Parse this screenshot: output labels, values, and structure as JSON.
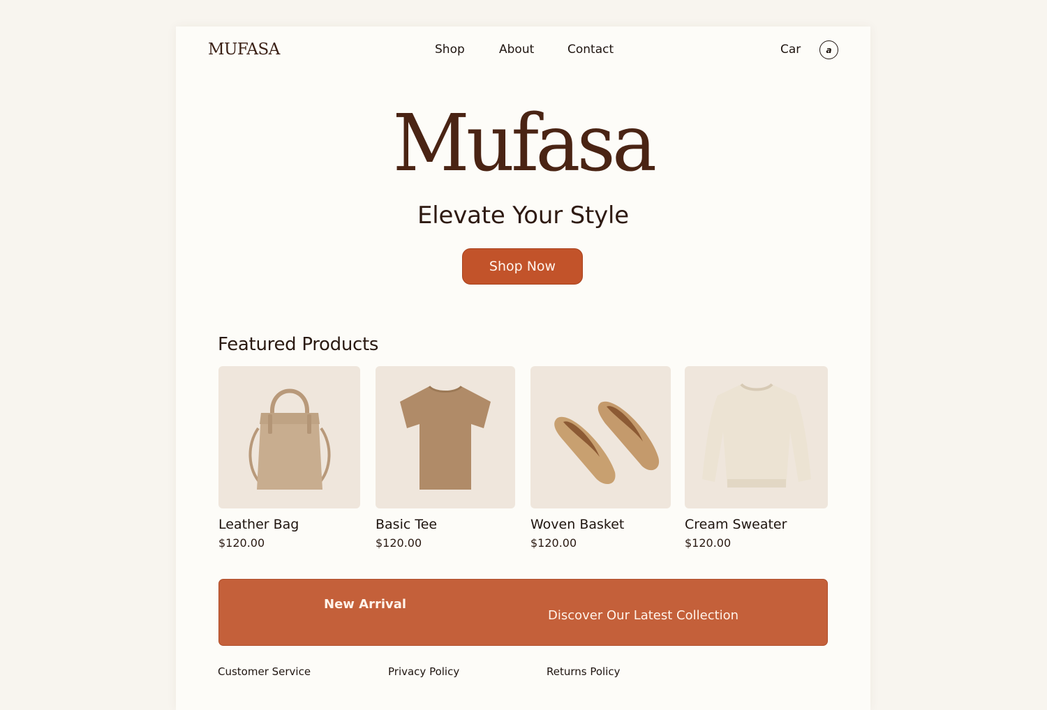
{
  "header": {
    "logo": "MUFASA",
    "nav": {
      "shop": "Shop",
      "about": "About",
      "contact": "Contact"
    },
    "cart": "Car",
    "account_icon": "user-circle-icon",
    "account_glyph": "a"
  },
  "hero": {
    "title": "Mufasa",
    "subtitle": "Elevate Your Style",
    "cta": "Shop Now"
  },
  "featured": {
    "title": "Featured Products",
    "products": [
      {
        "name": "Leather Bag",
        "price": "$120.00",
        "icon": "bag-icon"
      },
      {
        "name": "Basic Tee",
        "price": "$120.00",
        "icon": "tshirt-icon"
      },
      {
        "name": "Woven Basket",
        "price": "$120.00",
        "icon": "flat-shoes-icon"
      },
      {
        "name": "Cream Sweater",
        "price": "$120.00",
        "icon": "sweater-icon"
      }
    ]
  },
  "banner": {
    "left": "New Arrival",
    "right": "Discover Our Latest Collection"
  },
  "footer": {
    "links": [
      "Customer Service",
      "Privacy Policy",
      "Returns Policy"
    ]
  },
  "colors": {
    "accent": "#c2532a",
    "banner": "#c4603a",
    "hero_title": "#4a2414",
    "background": "#f8f5ef"
  }
}
